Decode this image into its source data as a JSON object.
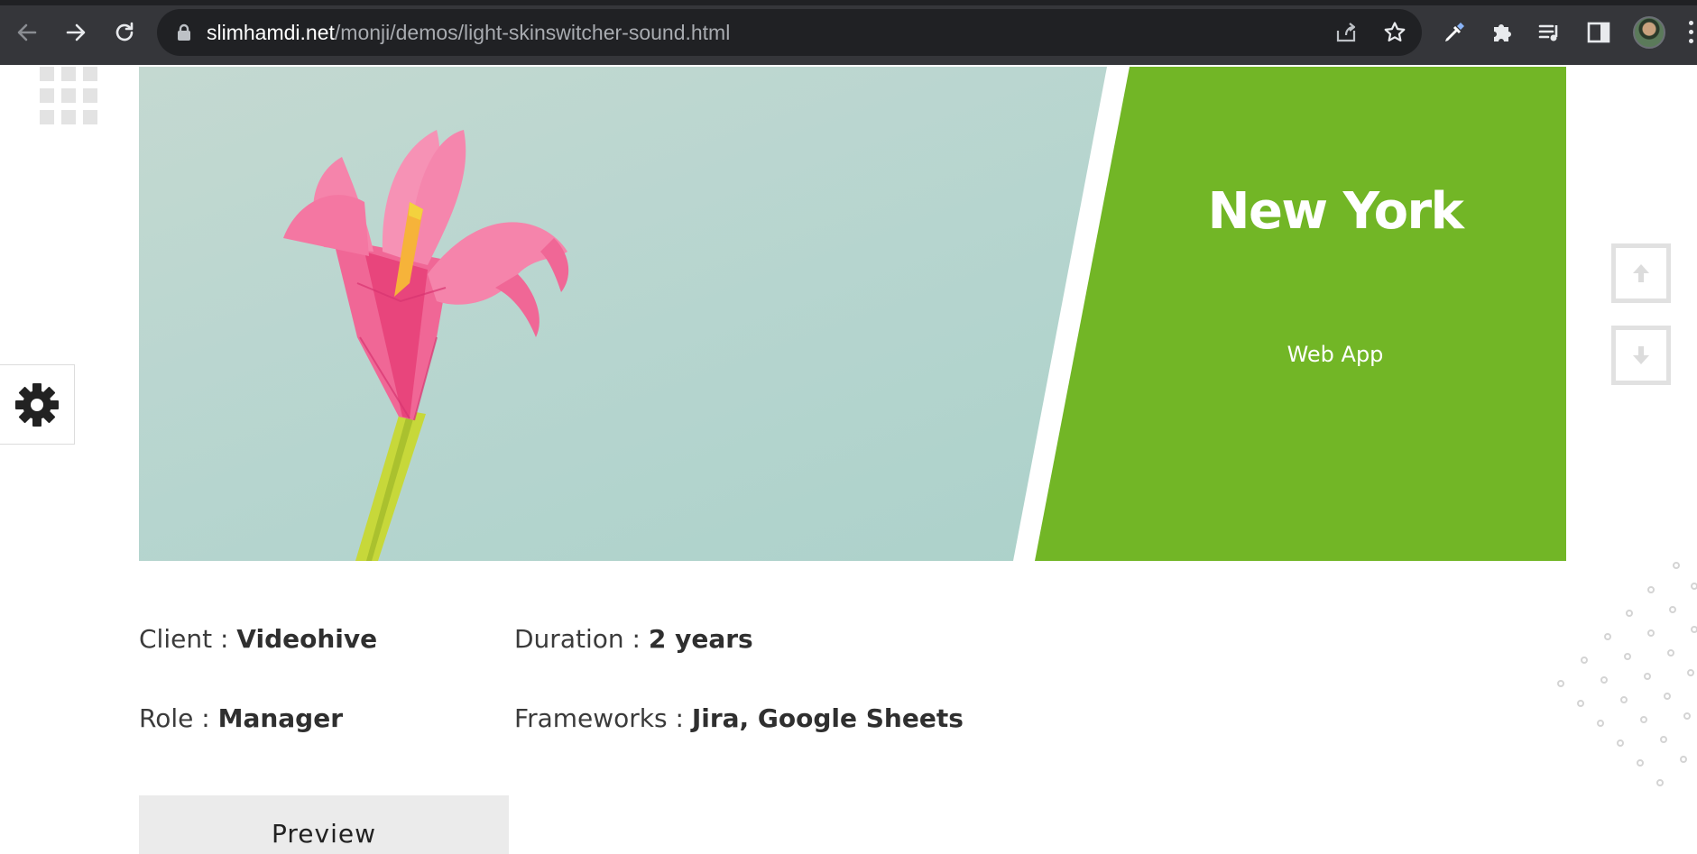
{
  "browser": {
    "url_host": "slimhamdi.net",
    "url_path": "/monji/demos/light-skinswitcher-sound.html",
    "icons": {
      "back": "arrow-left-icon",
      "forward": "arrow-right-icon",
      "reload": "reload-icon",
      "lock": "lock-icon",
      "share": "share-icon",
      "bookmark": "star-icon",
      "eyedropper": "eyedropper-icon",
      "extensions": "puzzle-icon",
      "media": "playlist-icon",
      "side_panel": "side-panel-icon",
      "profile": "avatar",
      "menu": "kebab-menu-icon"
    }
  },
  "page": {
    "colors": {
      "accent": "#72b626",
      "text": "#3b3b3b",
      "button_bg": "#ebebeb"
    },
    "hero": {
      "title": "New York",
      "subtitle": "Web App"
    },
    "details": {
      "client_label": "Client : ",
      "client_value": "Videohive",
      "duration_label": "Duration : ",
      "duration_value": "2 years",
      "role_label": "Role : ",
      "role_value": "Manager",
      "frameworks_label": "Frameworks : ",
      "frameworks_value": "Jira, Google Sheets"
    },
    "preview_button": "Preview",
    "controls": {
      "grid": "grid-icon",
      "settings": "gear-icon",
      "scroll_up": "arrow-up-icon",
      "scroll_down": "arrow-down-icon"
    }
  }
}
